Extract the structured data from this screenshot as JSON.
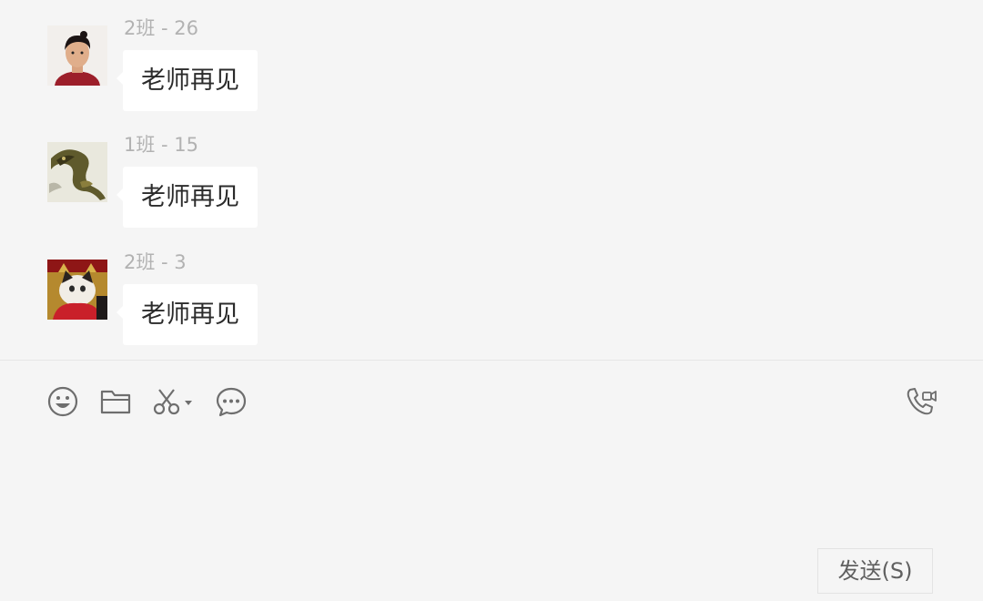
{
  "messages": [
    {
      "sender": "2班 - 26",
      "text": "老师再见",
      "avatar": "boy-portrait-avatar"
    },
    {
      "sender": "1班 - 15",
      "text": "老师再见",
      "avatar": "dragon-painting-avatar"
    },
    {
      "sender": "2班 - 3",
      "text": "老师再见",
      "avatar": "cat-red-scarf-avatar"
    }
  ],
  "toolbar": {
    "icons": [
      "emoji-icon",
      "folder-icon",
      "scissors-icon",
      "chat-bubble-icon",
      "video-call-icon"
    ]
  },
  "input": {
    "value": "",
    "placeholder": ""
  },
  "send_button": {
    "label": "发送(S)"
  },
  "colors": {
    "background": "#f5f5f5",
    "bubble": "#ffffff",
    "sender_text": "#b2b2b2",
    "message_text": "#2b2b2b",
    "icon": "#6e6e6e"
  }
}
